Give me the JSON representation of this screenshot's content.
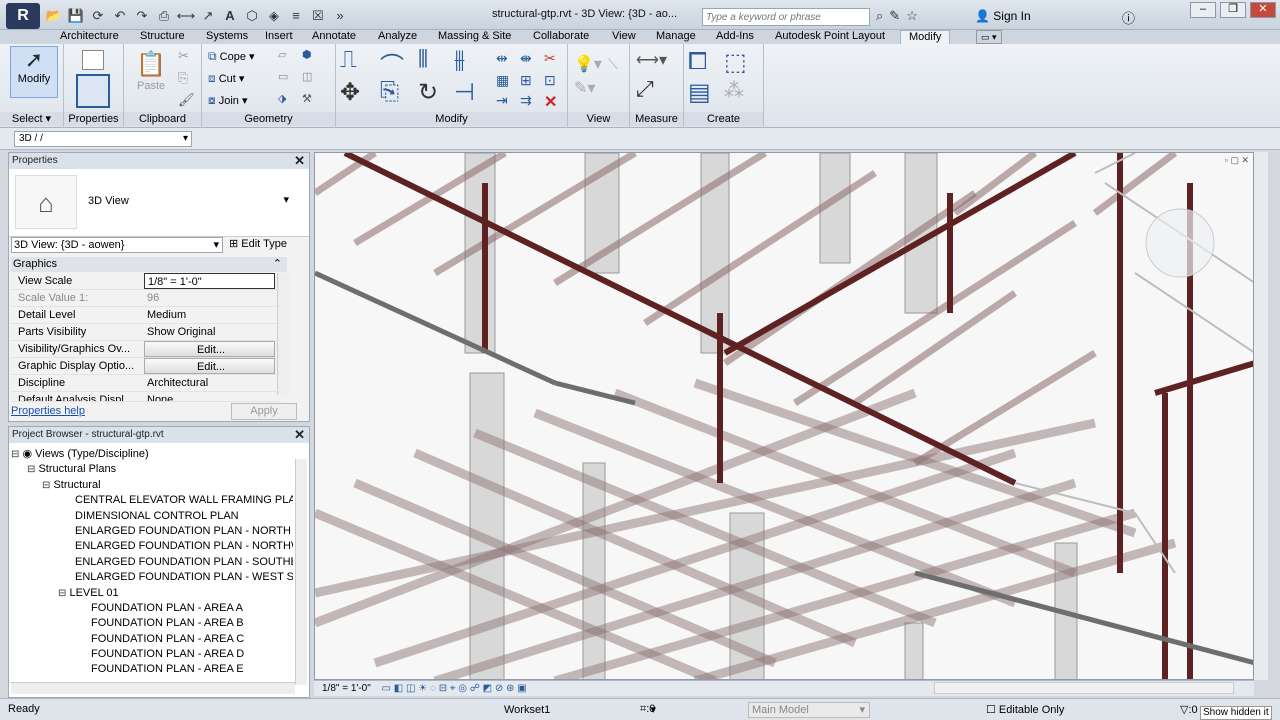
{
  "app": {
    "logo": "R",
    "title": "structural-gtp.rvt - 3D View: {3D - ao..."
  },
  "search": {
    "placeholder": "Type a keyword or phrase"
  },
  "signin": "Sign In",
  "tabs": [
    "Architecture",
    "Structure",
    "Systems",
    "Insert",
    "Annotate",
    "Analyze",
    "Massing & Site",
    "Collaborate",
    "View",
    "Manage",
    "Add-Ins",
    "Autodesk Point Layout",
    "Modify"
  ],
  "ribbon": {
    "modify_label": "Modify",
    "cope": "Cope",
    "cut": "Cut",
    "join": "Join",
    "paste": "Paste",
    "panels": {
      "select": "Select",
      "properties": "Properties",
      "clipboard": "Clipboard",
      "geometry": "Geometry",
      "modify": "Modify",
      "view": "View",
      "measure": "Measure",
      "create": "Create"
    }
  },
  "typebar": {
    "value": "3D  /  /"
  },
  "properties": {
    "title": "Properties",
    "type_name": "3D View",
    "view_selector": "3D View: {3D - aowen}",
    "edit_type": "Edit Type",
    "section": "Graphics",
    "rows": [
      {
        "k": "View Scale",
        "v": "1/8\" = 1'-0\""
      },
      {
        "k": "Scale Value    1:",
        "v": "96"
      },
      {
        "k": "Detail Level",
        "v": "Medium"
      },
      {
        "k": "Parts Visibility",
        "v": "Show Original"
      },
      {
        "k": "Visibility/Graphics Ov...",
        "v": "Edit..."
      },
      {
        "k": "Graphic Display Optio...",
        "v": "Edit..."
      },
      {
        "k": "Discipline",
        "v": "Architectural"
      },
      {
        "k": "Default Analysis Displ...",
        "v": "None"
      }
    ],
    "help": "Properties help",
    "apply": "Apply"
  },
  "browser": {
    "title": "Project Browser - structural-gtp.rvt",
    "items": [
      {
        "t": "Views (Type/Discipline)",
        "lvl": 0
      },
      {
        "t": "Structural Plans",
        "lvl": 1
      },
      {
        "t": "Structural",
        "lvl": 2
      },
      {
        "t": "CENTRAL ELEVATOR WALL FRAMING PLAN",
        "lvl": 3
      },
      {
        "t": "DIMENSIONAL CONTROL PLAN",
        "lvl": 3
      },
      {
        "t": "ENLARGED FOUNDATION PLAN - NORTH",
        "lvl": 3
      },
      {
        "t": "ENLARGED FOUNDATION PLAN - NORTHW",
        "lvl": 3
      },
      {
        "t": "ENLARGED FOUNDATION PLAN - SOUTHE",
        "lvl": 3
      },
      {
        "t": "ENLARGED FOUNDATION PLAN - WEST ST",
        "lvl": 3
      },
      {
        "t": "LEVEL 01",
        "lvl": 3
      },
      {
        "t": "FOUNDATION PLAN - AREA A",
        "lvl": 4
      },
      {
        "t": "FOUNDATION PLAN - AREA B",
        "lvl": 4
      },
      {
        "t": "FOUNDATION PLAN - AREA C",
        "lvl": 4
      },
      {
        "t": "FOUNDATION PLAN - AREA D",
        "lvl": 4
      },
      {
        "t": "FOUNDATION PLAN - AREA E",
        "lvl": 4
      }
    ]
  },
  "viewctl": {
    "scale": "1/8\" = 1'-0\""
  },
  "status": {
    "ready": "Ready",
    "workset": "Workset1",
    "main_model": "Main Model",
    "editable": "Editable Only",
    "filter": ":0",
    "zero": ":0",
    "show_hidden": "Show hidden it"
  },
  "colors": {
    "steel": "#6b2c2c",
    "glass": "#cfc3c3",
    "accent": "#2a5c9c"
  }
}
